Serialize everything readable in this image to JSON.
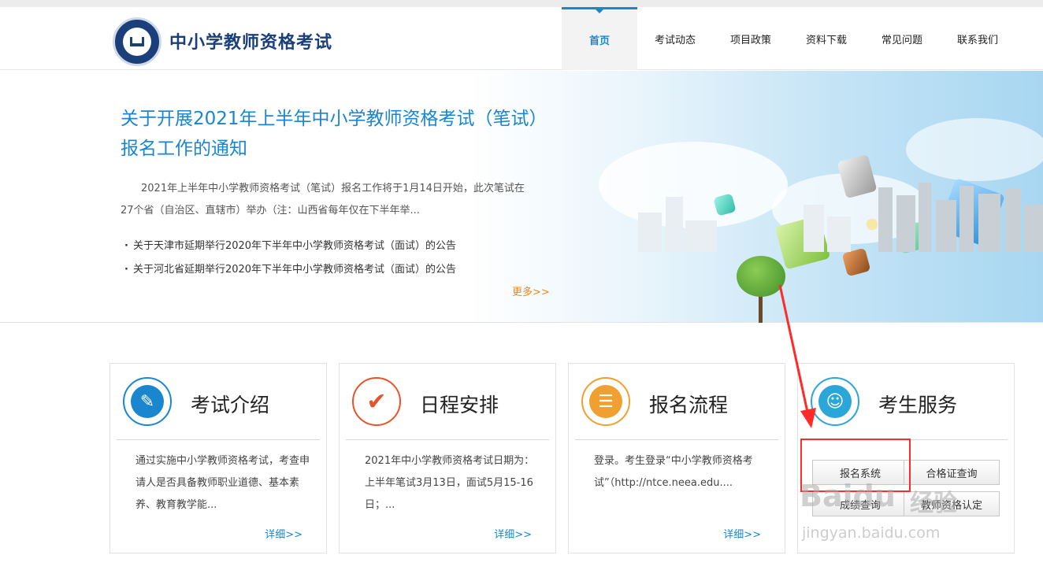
{
  "header": {
    "site_title": "中小学教师资格考试",
    "nav": [
      "首页",
      "考试动态",
      "项目政策",
      "资料下载",
      "常见问题",
      "联系我们"
    ],
    "active_nav": "首页",
    "accent_color": "#1a86d0"
  },
  "banner": {
    "news_title": "关于开展2021年上半年中小学教师资格考试（笔试）报名工作的通知",
    "news_summary": "2021年上半年中小学教师资格考试（笔试）报名工作将于1月14日开始，此次笔试在27个省（自治区、直辖市）举办（注：山西省每年仅在下半年举...",
    "news_items": [
      "关于天津市延期举行2020年下半年中小学教师资格考试（面试）的公告",
      "关于河北省延期举行2020年下半年中小学教师资格考试（面试）的公告"
    ],
    "more_label": "更多>>"
  },
  "cards": [
    {
      "title": "考试介绍",
      "text": "通过实施中小学教师资格考试，考查申请人是否具备教师职业道德、基本素养、教育教学能...",
      "more": "详细>>",
      "icon": "document-edit-icon"
    },
    {
      "title": "日程安排",
      "text": "2021年中小学教师资格考试日期为：上半年笔试3月13日，面试5月15-16日；...",
      "more": "详细>>",
      "icon": "checkmark-icon"
    },
    {
      "title": "报名流程",
      "text": "登录。考生登录“中小学教师资格考试”（http://ntce.neea.edu....",
      "more": "详细>>",
      "icon": "form-pen-icon"
    },
    {
      "title": "考生服务",
      "icon": "contact-book-icon",
      "buttons": [
        "报名系统",
        "合格证查询",
        "成绩查询",
        "教师资格认定"
      ]
    }
  ],
  "watermark": {
    "brand": "Baidu",
    "brand_cn": "经验",
    "url": "jingyan.baidu.com"
  }
}
